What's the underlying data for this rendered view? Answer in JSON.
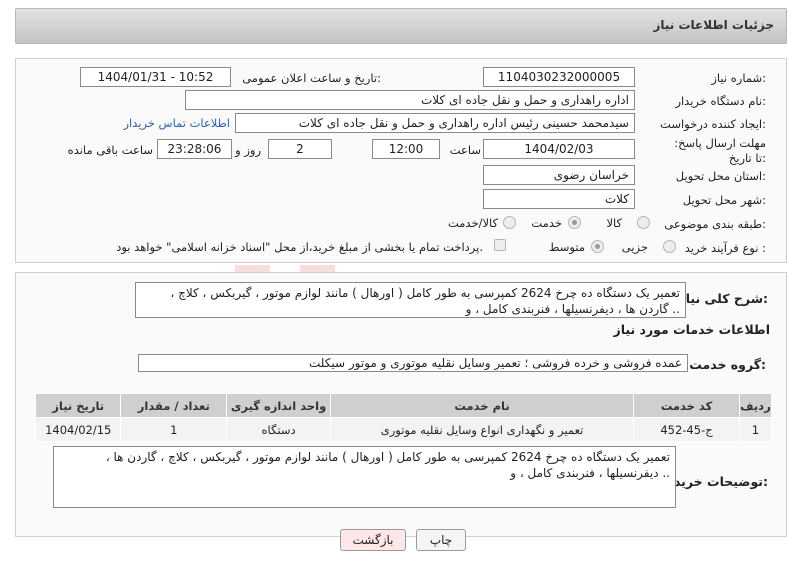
{
  "header": {
    "title": "جزئیات اطلاعات نیاز"
  },
  "fields": {
    "need_number_label": "شماره نیاز:",
    "need_number": "1104030232000005",
    "announce_label": "تاریخ و ساعت اعلان عمومی:",
    "announce_value": "1404/01/31 - 10:52",
    "buyer_org_label": "نام دستگاه خریدار:",
    "buyer_org": "اداره راهداری و حمل و نقل جاده ای کلات",
    "creator_label": "ایجاد کننده درخواست:",
    "creator": "سیدمحمد حسینی رئیس اداره راهداری و حمل و نقل جاده ای کلات",
    "contact_link": "اطلاعات تماس خریدار",
    "deadline_label": "مهلت ارسال پاسخ: تا تاریخ:",
    "deadline_date": "1404/02/03",
    "time_label": "ساعت",
    "deadline_time": "12:00",
    "days_count": "2",
    "days_label": "روز و",
    "remaining_time": "23:28:06",
    "remaining_label": "ساعت باقی مانده",
    "province_label": "استان محل تحویل:",
    "province": "خراسان رضوی",
    "city_label": "شهر محل تحویل:",
    "city": "کلات",
    "category_label": "طبقه بندی موضوعی:",
    "category_options": [
      "کالا",
      "خدمت",
      "کالا/خدمت"
    ],
    "purchase_type_label": "نوع فرآیند خرید :",
    "purchase_options": [
      "جزیی",
      "متوسط"
    ],
    "payment_note": "پرداخت تمام یا بخشی از مبلغ خرید،از محل \"اسناد خزانه اسلامی\" خواهد بود."
  },
  "summary": {
    "label": "شرح کلی نیاز:",
    "text": "تعمیر یک دستگاه ده چرخ 2624 کمپرسی به طور کامل ( اورهال ) مانند لوازم موتور ، گیربکس ، کلاچ ، گاردن ها ، دیفرنسیلها ، فنربندی کامل ، و .."
  },
  "services": {
    "title": "اطلاعات خدمات مورد نیاز",
    "group_label": "گروه خدمت:",
    "group_value": "عمده فروشی و خرده فروشی ؛ تعمیر وسایل نقلیه موتوری و موتور سیکلت",
    "columns": [
      "ردیف",
      "کد خدمت",
      "نام خدمت",
      "واحد اندازه گیری",
      "تعداد / مقدار",
      "تاریخ نیاز"
    ],
    "rows": [
      [
        "1",
        "ج-45-452",
        "تعمیر و نگهداری انواع وسایل نقلیه موتوری",
        "دستگاه",
        "1",
        "1404/02/15"
      ]
    ]
  },
  "buyer_notes": {
    "label": "توضیحات خریدار:",
    "text": "تعمیر یک دستگاه ده چرخ 2624 کمپرسی به طور کامل ( اورهال ) مانند لوازم موتور ، گیربکس ، کلاچ ، گاردن ها ، دیفرنسیلها ، فنربندی کامل ، و .."
  },
  "buttons": {
    "print": "چاپ",
    "back": "بازگشت"
  },
  "colors": {
    "back_button_bg": "#fde7e7",
    "link": "#2a63b0",
    "header_bg": "#cfcfcf"
  }
}
